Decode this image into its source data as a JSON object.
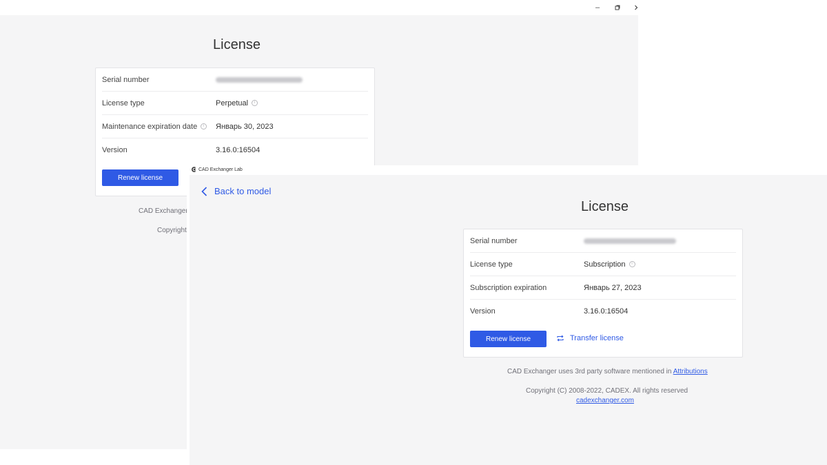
{
  "back_window": {
    "controls": {
      "minimize": "‒",
      "restore": "▫",
      "close": "›"
    },
    "title": "License",
    "rows": [
      {
        "label": "Serial number",
        "value": "",
        "value_blurred": true
      },
      {
        "label": "License type",
        "value": "Perpetual",
        "info": true
      },
      {
        "label": "Maintenance expiration date",
        "label_info": true,
        "value": "Январь 30, 2023"
      },
      {
        "label": "Version",
        "value": "3.16.0:16504"
      }
    ],
    "renew_button": "Renew license",
    "footer_line1": "CAD Exchanger",
    "footer_line2": "Copyright"
  },
  "front_window": {
    "app_title": "CAD Exchanger Lab",
    "back_link": "Back to model",
    "title": "License",
    "rows": [
      {
        "label": "Serial number",
        "value": "",
        "value_blurred": true
      },
      {
        "label": "License type",
        "value": "Subscription",
        "info": true
      },
      {
        "label": "Subscription expiration",
        "value": "Январь 27, 2023"
      },
      {
        "label": "Version",
        "value": "3.16.0:16504"
      }
    ],
    "renew_button": "Renew license",
    "transfer_link": "Transfer license",
    "footer": {
      "attributions_text": "CAD Exchanger uses 3rd party software mentioned in",
      "attributions_link": "Attributions",
      "copyright": "Copyright (C) 2008-2022, CADEX. All rights reserved",
      "website": "cadexchanger.com"
    }
  },
  "colors": {
    "accent": "#2f5ae5",
    "background": "#f5f5f6",
    "card": "#ffffff"
  }
}
